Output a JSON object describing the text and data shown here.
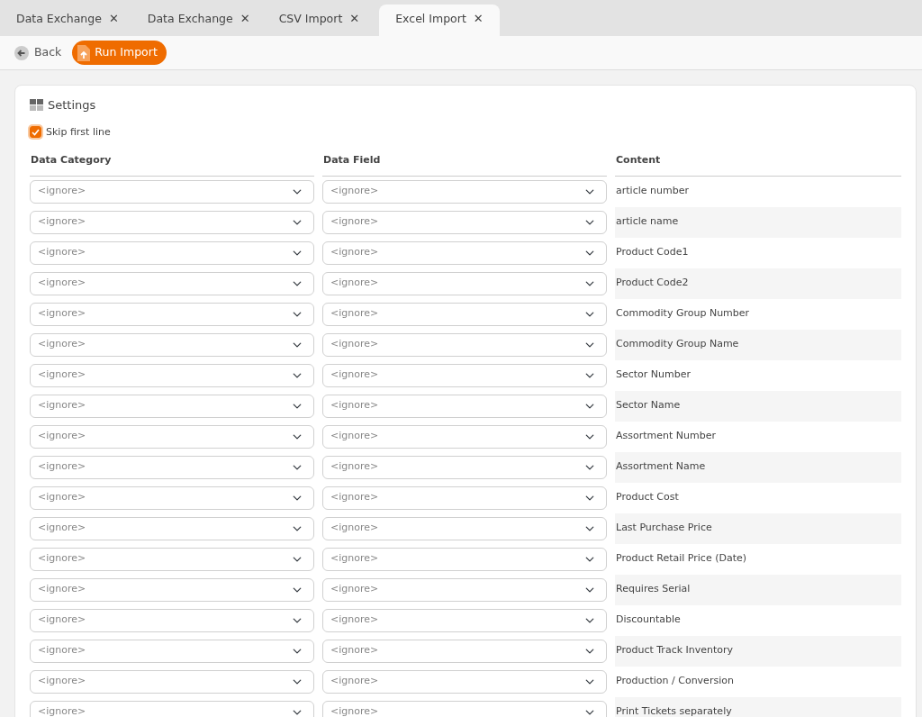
{
  "tabs": [
    {
      "label": "Data Exchange",
      "close": "✕",
      "selected": false
    },
    {
      "label": "Data Exchange",
      "close": "✕",
      "selected": false
    },
    {
      "label": "CSV Import",
      "close": "✕",
      "selected": false
    },
    {
      "label": "Excel Import",
      "close": "✕",
      "selected": true
    }
  ],
  "toolbar": {
    "back": "Back",
    "run": "Run Import"
  },
  "settings": {
    "title": "Settings",
    "skip_first_line": {
      "label": "Skip first line",
      "checked": true
    }
  },
  "table": {
    "columns": [
      "Data Category",
      "Data Field",
      "Content"
    ],
    "rows": [
      {
        "category": "<ignore>",
        "field": "<ignore>",
        "content": "article number"
      },
      {
        "category": "<ignore>",
        "field": "<ignore>",
        "content": "article name"
      },
      {
        "category": "<ignore>",
        "field": "<ignore>",
        "content": "Product Code1"
      },
      {
        "category": "<ignore>",
        "field": "<ignore>",
        "content": "Product Code2"
      },
      {
        "category": "<ignore>",
        "field": "<ignore>",
        "content": "Commodity Group Number"
      },
      {
        "category": "<ignore>",
        "field": "<ignore>",
        "content": "Commodity Group Name"
      },
      {
        "category": "<ignore>",
        "field": "<ignore>",
        "content": "Sector Number"
      },
      {
        "category": "<ignore>",
        "field": "<ignore>",
        "content": "Sector Name"
      },
      {
        "category": "<ignore>",
        "field": "<ignore>",
        "content": "Assortment Number"
      },
      {
        "category": "<ignore>",
        "field": "<ignore>",
        "content": "Assortment Name"
      },
      {
        "category": "<ignore>",
        "field": "<ignore>",
        "content": "Product Cost"
      },
      {
        "category": "<ignore>",
        "field": "<ignore>",
        "content": "Last Purchase Price"
      },
      {
        "category": "<ignore>",
        "field": "<ignore>",
        "content": "Product Retail Price (Date)"
      },
      {
        "category": "<ignore>",
        "field": "<ignore>",
        "content": "Requires Serial"
      },
      {
        "category": "<ignore>",
        "field": "<ignore>",
        "content": "Discountable"
      },
      {
        "category": "<ignore>",
        "field": "<ignore>",
        "content": "Product Track Inventory"
      },
      {
        "category": "<ignore>",
        "field": "<ignore>",
        "content": "Production / Conversion"
      },
      {
        "category": "<ignore>",
        "field": "<ignore>",
        "content": "Print Tickets separately"
      }
    ]
  }
}
